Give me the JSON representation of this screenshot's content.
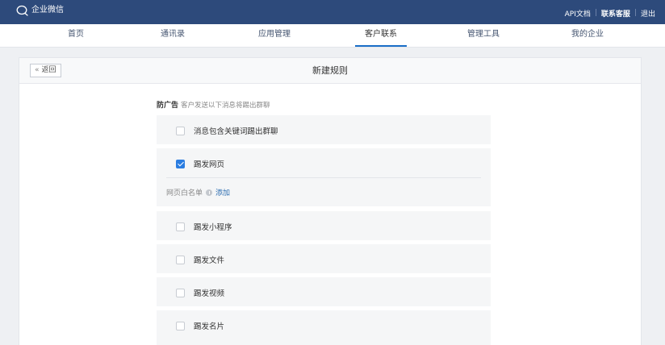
{
  "topbar": {
    "brand": "企业微信",
    "links": [
      "API文档",
      "联系客服",
      "退出"
    ]
  },
  "nav": {
    "items": [
      "首页",
      "通讯录",
      "应用管理",
      "客户联系",
      "管理工具",
      "我的企业"
    ],
    "active": "客户联系"
  },
  "panel": {
    "back_label": "返回",
    "title": "新建规则"
  },
  "rule": {
    "heading": "防广告",
    "description": "客户发送以下消息将踢出群聊",
    "options": [
      {
        "label": "消息包含关键词踢出群聊",
        "checked": false
      },
      {
        "label": "踢发网页",
        "checked": true
      },
      {
        "label": "踢发小程序",
        "checked": false
      },
      {
        "label": "踢发文件",
        "checked": false
      },
      {
        "label": "踢发视频",
        "checked": false
      },
      {
        "label": "踢发名片",
        "checked": false
      }
    ],
    "whitelist_label": "网页白名单",
    "whitelist_add": "添加"
  },
  "colors": {
    "topbar": "#2d4a7b",
    "accent": "#2b7de1",
    "nav_underline": "#1a6ec7"
  }
}
